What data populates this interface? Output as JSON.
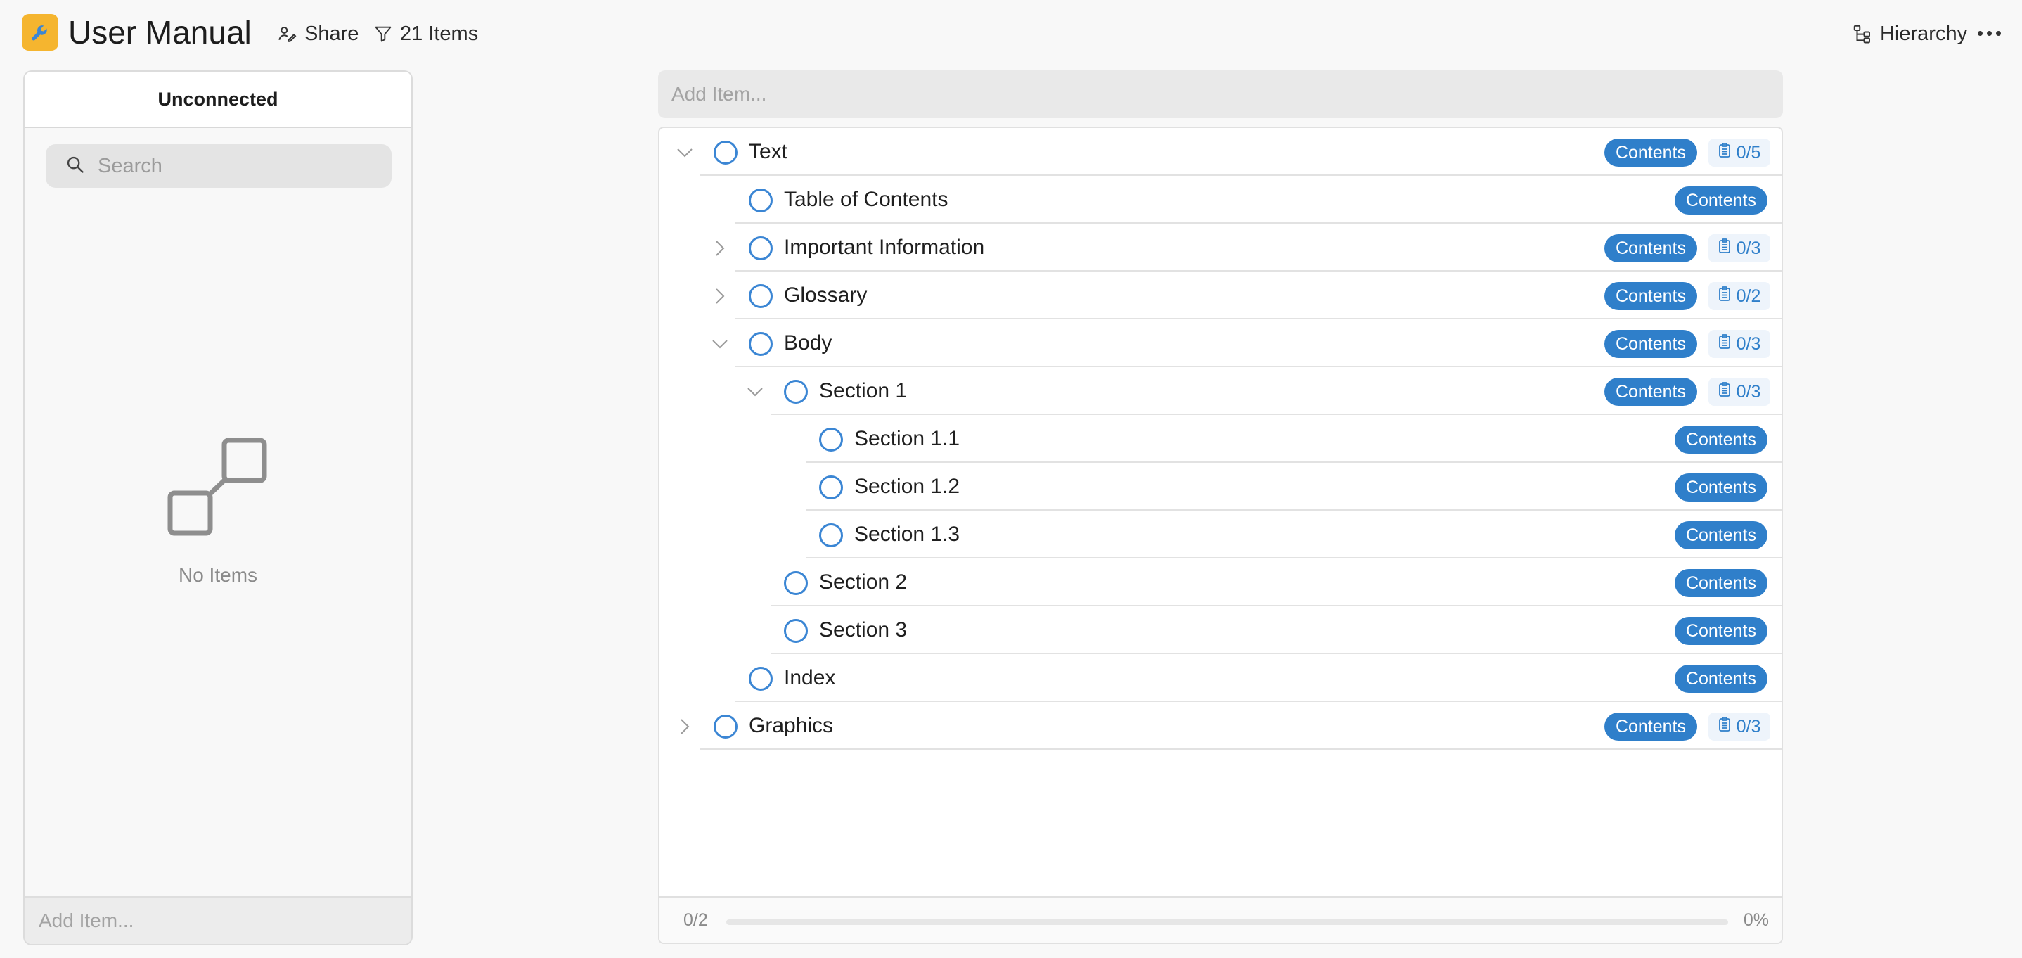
{
  "header": {
    "title": "User Manual",
    "app_icon": "wrench-icon",
    "share_label": "Share",
    "filter_label": "21 Items",
    "hierarchy_label": "Hierarchy"
  },
  "left_panel": {
    "title": "Unconnected",
    "search_placeholder": "Search",
    "empty_label": "No Items",
    "add_placeholder": "Add Item..."
  },
  "main": {
    "add_placeholder": "Add Item...",
    "rows": [
      {
        "label": "Text",
        "depth": 0,
        "expander": "expanded",
        "tag": "Contents",
        "count": "0/5"
      },
      {
        "label": "Table of Contents",
        "depth": 1,
        "expander": "none",
        "tag": "Contents",
        "count": ""
      },
      {
        "label": "Important Information",
        "depth": 1,
        "expander": "collapsed",
        "tag": "Contents",
        "count": "0/3"
      },
      {
        "label": "Glossary",
        "depth": 1,
        "expander": "collapsed",
        "tag": "Contents",
        "count": "0/2"
      },
      {
        "label": "Body",
        "depth": 1,
        "expander": "expanded",
        "tag": "Contents",
        "count": "0/3"
      },
      {
        "label": "Section 1",
        "depth": 2,
        "expander": "expanded",
        "tag": "Contents",
        "count": "0/3"
      },
      {
        "label": "Section 1.1",
        "depth": 3,
        "expander": "none",
        "tag": "Contents",
        "count": ""
      },
      {
        "label": "Section 1.2",
        "depth": 3,
        "expander": "none",
        "tag": "Contents",
        "count": ""
      },
      {
        "label": "Section 1.3",
        "depth": 3,
        "expander": "none",
        "tag": "Contents",
        "count": ""
      },
      {
        "label": "Section 2",
        "depth": 2,
        "expander": "none",
        "tag": "Contents",
        "count": ""
      },
      {
        "label": "Section 3",
        "depth": 2,
        "expander": "none",
        "tag": "Contents",
        "count": ""
      },
      {
        "label": "Index",
        "depth": 1,
        "expander": "none",
        "tag": "Contents",
        "count": ""
      },
      {
        "label": "Graphics",
        "depth": 0,
        "expander": "collapsed",
        "tag": "Contents",
        "count": "0/3"
      }
    ],
    "footer": {
      "completed": "0/2",
      "percent_label": "0%",
      "progress": 0
    }
  },
  "colors": {
    "accent": "#2f7fca",
    "app_icon_bg": "#f5b52f"
  }
}
